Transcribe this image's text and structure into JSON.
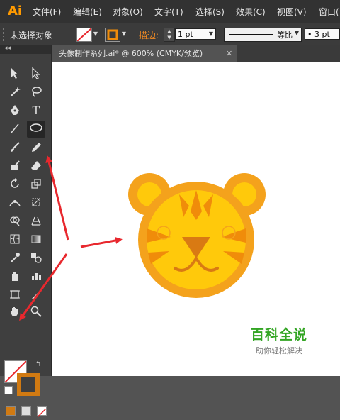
{
  "app": {
    "logo": "Ai",
    "accent": "#ff9a00"
  },
  "menu": [
    "文件(F)",
    "编辑(E)",
    "对象(O)",
    "文字(T)",
    "选择(S)",
    "效果(C)",
    "视图(V)",
    "窗口("
  ],
  "control_bar": {
    "selection_status": "未选择对象",
    "stroke_label": "描边:",
    "stroke_weight": "1 pt",
    "line_style_label": "等比",
    "brush_size": "• 3 pt"
  },
  "document_tab": {
    "title": "头像制作系列.ai* @ 600% (CMYK/预览)",
    "close": "✕"
  },
  "tools": {
    "type_tool_glyph": "T",
    "collapse_glyph": "◂◂"
  },
  "colors": {
    "fill": "#ffffff",
    "stroke": "#d17a12",
    "tiger_outer": "#f4a21c",
    "tiger_face": "#ffc90b",
    "tiger_stripe": "#f08c0a",
    "tiger_nose": "#d97a13",
    "arrow": "#e8282e"
  },
  "watermark": {
    "title": "百科全说",
    "subtitle": "助你轻松解决"
  }
}
